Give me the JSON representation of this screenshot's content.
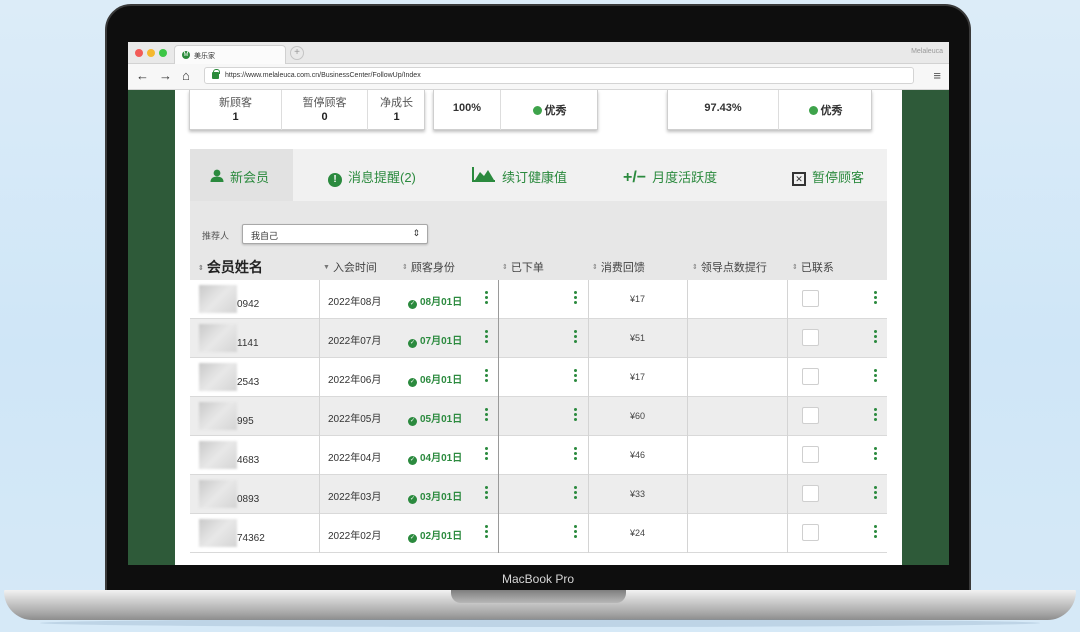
{
  "browser": {
    "tab_title": "美乐家",
    "url": "https://www.melaleuca.com.cn/BusinessCenter/FollowUp/Index",
    "profile_name": "Melaleuca",
    "new_tab_symbol": "+",
    "back_symbol": "←",
    "forward_symbol": "→",
    "home_symbol": "⌂",
    "menu_symbol": "≡",
    "favicon_letter": "M"
  },
  "device_label": "MacBook Pro",
  "stats": {
    "new_customers_label": "新顾客",
    "new_customers_value": "1",
    "paused_customers_label": "暂停顾客",
    "paused_customers_value": "0",
    "net_growth_label": "净成长",
    "net_growth_value": "1",
    "rate_1": "100%",
    "rating_1": "优秀",
    "rate_2": "97.43%",
    "rating_2": "优秀"
  },
  "colors": {
    "brand_green": "#2b8a3e",
    "status_green": "#3ea34b",
    "frame_green": "#2e5a39"
  },
  "tabs": [
    {
      "label": "新会员",
      "icon": "user-icon",
      "glyph": "👤",
      "active": true
    },
    {
      "label": "消息提醒(2)",
      "icon": "alert-icon",
      "glyph": "!",
      "active": false
    },
    {
      "label": "续订健康值",
      "icon": "chart-icon",
      "glyph": "▲",
      "active": false
    },
    {
      "label": "月度活跃度",
      "icon": "plus-minus-icon",
      "glyph": "+/−",
      "active": false
    },
    {
      "label": "暂停顾客",
      "icon": "close-box-icon",
      "glyph": "✕",
      "active": false
    }
  ],
  "filter": {
    "label": "推荐人",
    "selected": "我自己",
    "arrow": "⇕"
  },
  "table": {
    "columns": [
      {
        "label": "会员姓名",
        "sort": "⇕"
      },
      {
        "label": "入会时间",
        "sort": "▼"
      },
      {
        "label": "顾客身份",
        "sort": "⇕"
      },
      {
        "label": "已下单",
        "sort": "⇕"
      },
      {
        "label": "消费回馈",
        "sort": "⇕"
      },
      {
        "label": "领导点数提行",
        "sort": "⇕"
      },
      {
        "label": "已联系",
        "sort": "⇕"
      }
    ],
    "rows": [
      {
        "id_suffix": "0942",
        "join_date": "2022年08月",
        "status": "08月01日",
        "rebate": "¥17"
      },
      {
        "id_suffix": "1141",
        "join_date": "2022年07月",
        "status": "07月01日",
        "rebate": "¥51"
      },
      {
        "id_suffix": "2543",
        "join_date": "2022年06月",
        "status": "06月01日",
        "rebate": "¥17"
      },
      {
        "id_suffix": "995",
        "join_date": "2022年05月",
        "status": "05月01日",
        "rebate": "¥60"
      },
      {
        "id_suffix": "4683",
        "join_date": "2022年04月",
        "status": "04月01日",
        "rebate": "¥46"
      },
      {
        "id_suffix": "0893",
        "join_date": "2022年03月",
        "status": "03月01日",
        "rebate": "¥33"
      },
      {
        "id_suffix": "74362",
        "join_date": "2022年02月",
        "status": "02月01日",
        "rebate": "¥24"
      }
    ]
  }
}
